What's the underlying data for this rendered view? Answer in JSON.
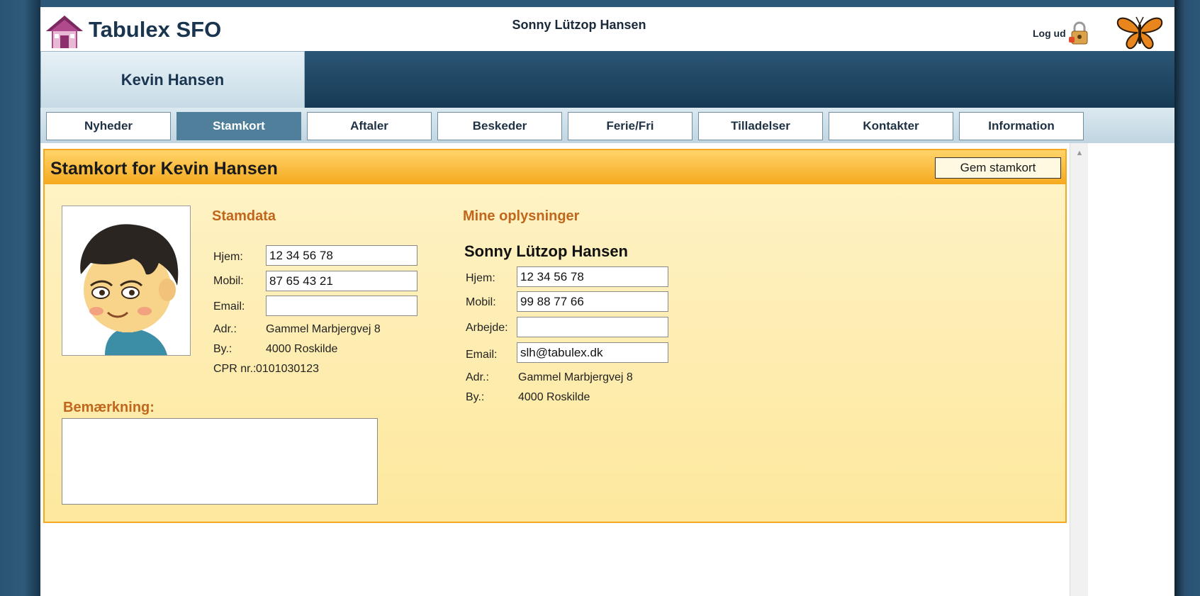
{
  "header": {
    "app_title": "Tabulex SFO",
    "user_name": "Sonny Lützop Hansen",
    "logout_label": "Log ud"
  },
  "child_tab": {
    "label": "Kevin Hansen"
  },
  "nav": {
    "items": [
      {
        "label": "Nyheder"
      },
      {
        "label": "Stamkort",
        "active": true
      },
      {
        "label": "Aftaler"
      },
      {
        "label": "Beskeder"
      },
      {
        "label": "Ferie/Fri"
      },
      {
        "label": "Tilladelser"
      },
      {
        "label": "Kontakter"
      },
      {
        "label": "Information"
      }
    ]
  },
  "panel": {
    "title": "Stamkort for Kevin Hansen",
    "save_label": "Gem stamkort"
  },
  "stamdata": {
    "title": "Stamdata",
    "hjem_label": "Hjem:",
    "hjem_value": "12 34 56 78",
    "mobil_label": "Mobil:",
    "mobil_value": "87 65 43 21",
    "email_label": "Email:",
    "email_value": "",
    "adr_label": "Adr.:",
    "adr_value": "Gammel Marbjergvej 8",
    "by_label": "By.:",
    "by_value": "4000 Roskilde",
    "cpr_label": "CPR nr.:",
    "cpr_value": "0101030123"
  },
  "mine": {
    "title": "Mine oplysninger",
    "name": "Sonny Lützop Hansen",
    "hjem_label": "Hjem:",
    "hjem_value": "12 34 56 78",
    "mobil_label": "Mobil:",
    "mobil_value": "99 88 77 66",
    "arbejde_label": "Arbejde:",
    "arbejde_value": "",
    "email_label": "Email:",
    "email_value": "slh@tabulex.dk",
    "adr_label": "Adr.:",
    "adr_value": "Gammel Marbjergvej 8",
    "by_label": "By.:",
    "by_value": "4000 Roskilde"
  },
  "remark": {
    "title": "Bemærkning:",
    "value": ""
  },
  "colors": {
    "brand_blue": "#1a3550",
    "accent_orange": "#f6a91e",
    "section_title": "#c0661d",
    "active_tab": "#4f7f9a"
  },
  "icons": [
    "house-logo-icon",
    "lock-icon",
    "butterfly-icon",
    "scroll-up-arrow-icon"
  ]
}
